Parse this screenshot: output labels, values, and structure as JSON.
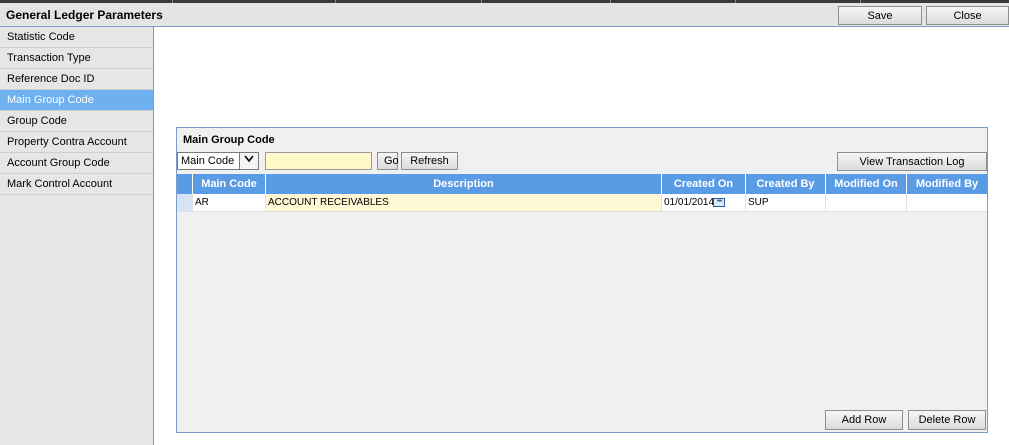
{
  "window": {
    "title": "General Ledger Parameters"
  },
  "toolbar": {
    "save_label": "Save",
    "close_label": "Close"
  },
  "sidebar": {
    "items": [
      {
        "label": "Statistic Code"
      },
      {
        "label": "Transaction Type"
      },
      {
        "label": "Reference Doc ID"
      },
      {
        "label": "Main Group Code",
        "active": true
      },
      {
        "label": "Group Code"
      },
      {
        "label": "Property Contra Account"
      },
      {
        "label": "Account Group Code"
      },
      {
        "label": "Mark Control Account"
      }
    ]
  },
  "panel": {
    "title": "Main Group Code",
    "filter": {
      "selected": "Main Code",
      "value": ""
    },
    "go_label": "Go",
    "refresh_label": "Refresh",
    "view_log_label": "View Transaction Log",
    "add_row_label": "Add Row",
    "delete_row_label": "Delete Row",
    "columns": [
      "Main Code",
      "Description",
      "Created On",
      "Created By",
      "Modified On",
      "Modified By"
    ],
    "rows": [
      {
        "main_code": "AR",
        "description": "ACCOUNT RECEIVABLES",
        "created_on": "01/01/2014",
        "created_by": "SUP",
        "modified_on": "",
        "modified_by": ""
      }
    ]
  },
  "icons": {
    "lookup": "ellipsis-lookup-icon",
    "dropdown": "chevron-down-icon"
  },
  "colors": {
    "accent": "#5a9be6",
    "active_item": "#6fb0f0",
    "input_highlight": "#fff8c8"
  }
}
